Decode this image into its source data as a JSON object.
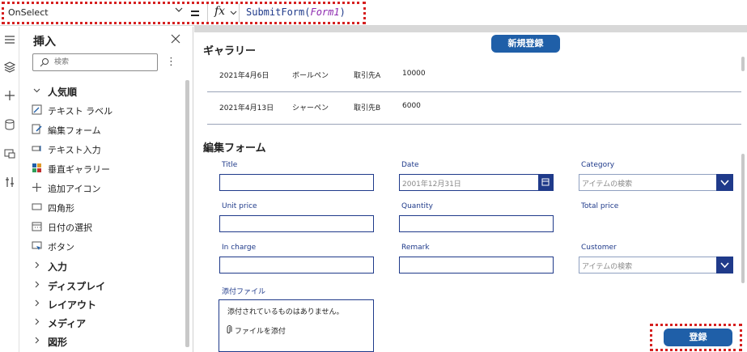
{
  "formula_bar": {
    "property": "OnSelect",
    "equals": "=",
    "fx_label": "fx",
    "formula_func": "SubmitForm(",
    "formula_arg": "Form1",
    "formula_close": ")"
  },
  "rail": {
    "icons": [
      "hamburger-icon",
      "layers-icon",
      "plus-icon",
      "database-icon",
      "media-icon",
      "tools-icon"
    ]
  },
  "insert_panel": {
    "title": "挿入",
    "search_placeholder": "検索",
    "items": [
      {
        "label": "人気順",
        "icon": "chevron-down-icon",
        "group": true
      },
      {
        "label": "テキスト ラベル",
        "icon": "text-label-icon",
        "group": false
      },
      {
        "label": "編集フォーム",
        "icon": "edit-form-icon",
        "group": false
      },
      {
        "label": "テキスト入力",
        "icon": "text-input-icon",
        "group": false
      },
      {
        "label": "垂直ギャラリー",
        "icon": "gallery-icon",
        "group": false
      },
      {
        "label": "追加アイコン",
        "icon": "plus-icon",
        "group": false
      },
      {
        "label": "四角形",
        "icon": "rectangle-icon",
        "group": false
      },
      {
        "label": "日付の選択",
        "icon": "calendar-icon",
        "group": false
      },
      {
        "label": "ボタン",
        "icon": "button-icon",
        "group": false
      },
      {
        "label": "入力",
        "icon": "chevron-right-icon",
        "group": true
      },
      {
        "label": "ディスプレイ",
        "icon": "chevron-right-icon",
        "group": true
      },
      {
        "label": "レイアウト",
        "icon": "chevron-right-icon",
        "group": true
      },
      {
        "label": "メディア",
        "icon": "chevron-right-icon",
        "group": true
      },
      {
        "label": "図形",
        "icon": "chevron-right-icon",
        "group": true
      }
    ]
  },
  "gallery": {
    "title": "ギャラリー",
    "new_button": "新規登録",
    "rows": [
      {
        "date": "2021年4月6日",
        "item": "ボールペン",
        "client": "取引先A",
        "amount": "10000"
      },
      {
        "date": "2021年4月13日",
        "item": "シャーペン",
        "client": "取引先B",
        "amount": "6000"
      }
    ]
  },
  "form": {
    "title": "編集フォーム",
    "labels": {
      "title": "Title",
      "date": "Date",
      "category": "Category",
      "unit_price": "Unit price",
      "quantity": "Quantity",
      "total_price": "Total price",
      "in_charge": "In charge",
      "remark": "Remark",
      "customer": "Customer",
      "attachment": "添付ファイル"
    },
    "date_placeholder": "2001年12月31日",
    "category_placeholder": "アイテムの検索",
    "customer_placeholder": "アイテムの検索",
    "attachment_empty": "添付されているものはありません。",
    "attachment_add": "ファイルを添付",
    "submit_button": "登録"
  },
  "colors": {
    "accent": "#1f5fa8",
    "field_border": "#1f3a8a",
    "highlight": "#d62020"
  }
}
